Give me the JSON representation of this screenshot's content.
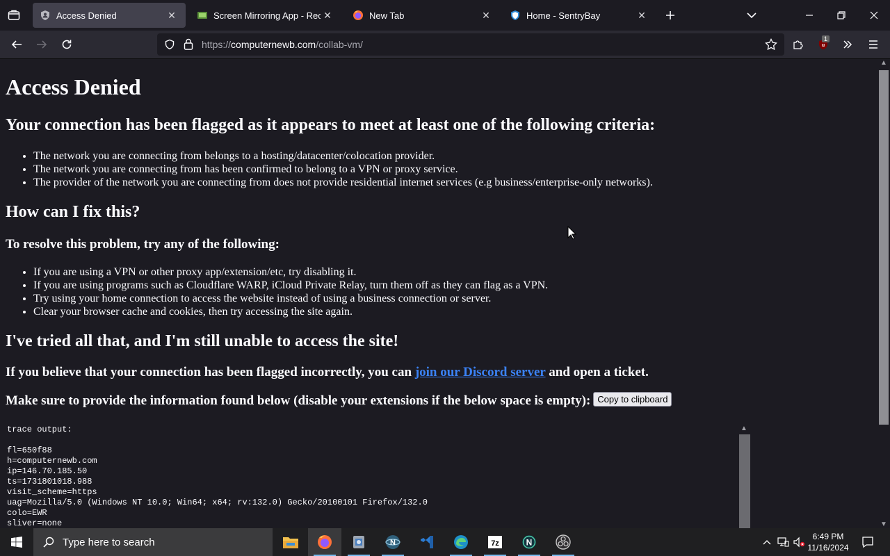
{
  "browser": {
    "tabs": [
      {
        "title": "Access Denied",
        "active": true,
        "icon": "shield-user-icon"
      },
      {
        "title": "Screen Mirroring App - Receive",
        "active": false,
        "icon": "app-icon"
      },
      {
        "title": "New Tab",
        "active": false,
        "icon": "firefox-icon"
      },
      {
        "title": "Home - SentryBay",
        "active": false,
        "icon": "sentrybay-shield-icon"
      }
    ],
    "url": {
      "scheme": "https://",
      "host": "computernewb.com",
      "path": "/collab-vm/"
    },
    "extension_badge": "1"
  },
  "page": {
    "title": "Access Denied",
    "flagged_heading": "Your connection has been flagged as it appears to meet at least one of the following criteria:",
    "criteria": [
      "The network you are connecting from belongs to a hosting/datacenter/colocation provider.",
      "The network you are connecting from has been confirmed to belong to a VPN or proxy service.",
      "The provider of the network you are connecting from does not provide residential internet services (e.g business/enterprise-only networks)."
    ],
    "fix_heading": "How can I fix this?",
    "resolve_heading": "To resolve this problem, try any of the following:",
    "fixes": [
      "If you are using a VPN or other proxy app/extension/etc, try disabling it.",
      "If you are using programs such as Cloudflare WARP, iCloud Private Relay, turn them off as they can flag as a VPN.",
      "Try using your home connection to access the website instead of using a business connection or server.",
      "Clear your browser cache and cookies, then try accessing the site again."
    ],
    "still_heading": "I've tried all that, and I'm still unable to access the site!",
    "ticket_prefix": "If you believe that your connection has been flagged incorrectly, you can ",
    "ticket_link": "join our Discord server",
    "ticket_suffix": " and open a ticket.",
    "provide_text": "Make sure to provide the information found below (disable your extensions if the below space is empty):",
    "copy_button": "Copy to clipboard",
    "trace": "trace output:\n\nfl=650f88\nh=computernewb.com\nip=146.70.185.50\nts=1731801018.988\nvisit_scheme=https\nuag=Mozilla/5.0 (Windows NT 10.0; Win64; x64; rv:132.0) Gecko/20100101 Firefox/132.0\ncolo=EWR\nsliver=none"
  },
  "taskbar": {
    "search_placeholder": "Type here to search",
    "apps": [
      "file-explorer-icon",
      "firefox-icon",
      "app-installer-icon",
      "network-app-icon",
      "visual-studio-icon",
      "edge-icon",
      "7zip-icon",
      "n-app-icon",
      "obs-icon"
    ],
    "time": "6:49 PM",
    "date": "11/16/2024"
  },
  "colors": {
    "accent_link": "#3b82f6",
    "page_bg": "#1c1b22",
    "taskbar_indicator": "#76b9ed"
  }
}
